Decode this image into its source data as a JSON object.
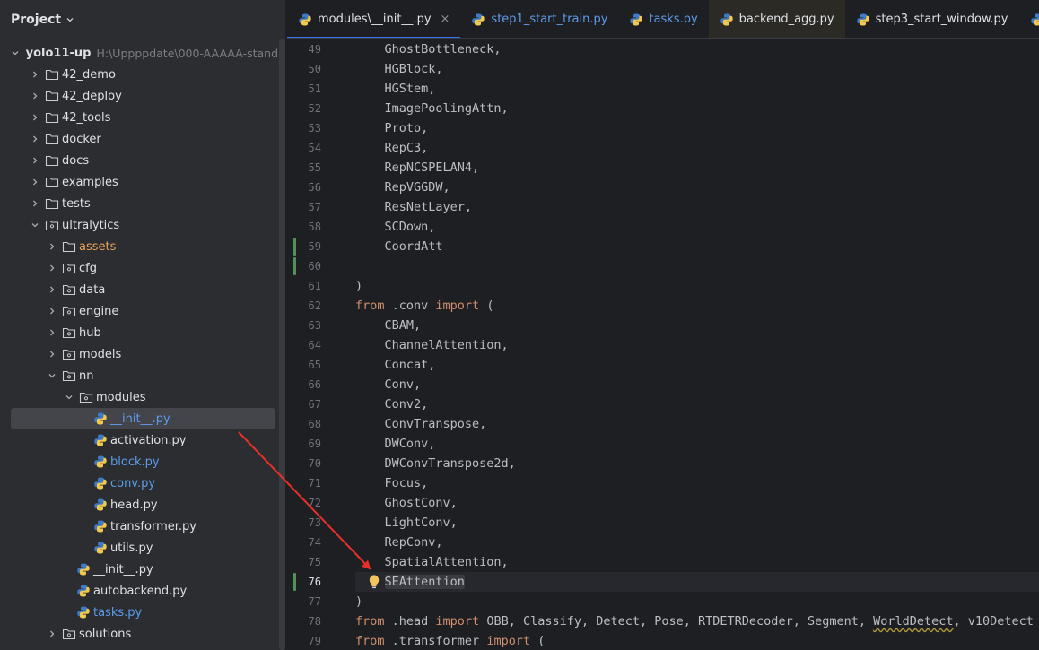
{
  "project_panel": {
    "title": "Project",
    "tree": [
      {
        "label": "yolo11-up",
        "path": "H:\\Uppppdate\\000-AAAAA-stand",
        "depth": 0,
        "expanded": true,
        "type": "folder",
        "style": "bold"
      },
      {
        "label": "42_demo",
        "depth": 1,
        "expanded": false,
        "type": "folder"
      },
      {
        "label": "42_deploy",
        "depth": 1,
        "expanded": false,
        "type": "folder"
      },
      {
        "label": "42_tools",
        "depth": 1,
        "expanded": false,
        "type": "folder"
      },
      {
        "label": "docker",
        "depth": 1,
        "expanded": false,
        "type": "folder"
      },
      {
        "label": "docs",
        "depth": 1,
        "expanded": false,
        "type": "folder"
      },
      {
        "label": "examples",
        "depth": 1,
        "expanded": false,
        "type": "folder"
      },
      {
        "label": "tests",
        "depth": 1,
        "expanded": false,
        "type": "folder"
      },
      {
        "label": "ultralytics",
        "depth": 1,
        "expanded": true,
        "type": "package"
      },
      {
        "label": "assets",
        "depth": 2,
        "expanded": false,
        "type": "folder",
        "style": "orange"
      },
      {
        "label": "cfg",
        "depth": 2,
        "expanded": false,
        "type": "package"
      },
      {
        "label": "data",
        "depth": 2,
        "expanded": false,
        "type": "package"
      },
      {
        "label": "engine",
        "depth": 2,
        "expanded": false,
        "type": "package"
      },
      {
        "label": "hub",
        "depth": 2,
        "expanded": false,
        "type": "package"
      },
      {
        "label": "models",
        "depth": 2,
        "expanded": false,
        "type": "package"
      },
      {
        "label": "nn",
        "depth": 2,
        "expanded": true,
        "type": "package"
      },
      {
        "label": "modules",
        "depth": 3,
        "expanded": true,
        "type": "package"
      },
      {
        "label": "__init__.py",
        "depth": 4,
        "type": "py",
        "style": "blue",
        "selected": true
      },
      {
        "label": "activation.py",
        "depth": 4,
        "type": "py"
      },
      {
        "label": "block.py",
        "depth": 4,
        "type": "py",
        "style": "blue"
      },
      {
        "label": "conv.py",
        "depth": 4,
        "type": "py",
        "style": "blue"
      },
      {
        "label": "head.py",
        "depth": 4,
        "type": "py"
      },
      {
        "label": "transformer.py",
        "depth": 4,
        "type": "py"
      },
      {
        "label": "utils.py",
        "depth": 4,
        "type": "py"
      },
      {
        "label": "__init__.py",
        "depth": 3,
        "type": "py"
      },
      {
        "label": "autobackend.py",
        "depth": 3,
        "type": "py"
      },
      {
        "label": "tasks.py",
        "depth": 3,
        "type": "py",
        "style": "blue"
      },
      {
        "label": "solutions",
        "depth": 2,
        "expanded": false,
        "type": "package"
      }
    ]
  },
  "editor": {
    "tabs": [
      {
        "label": "modules\\__init__.py",
        "active": true,
        "closable": true,
        "style": "mod"
      },
      {
        "label": "step1_start_train.py",
        "style": "blue"
      },
      {
        "label": "tasks.py",
        "style": "blue"
      },
      {
        "label": "backend_agg.py",
        "style": "plain",
        "highlight": true
      },
      {
        "label": "step3_start_window.py",
        "style": "plain"
      }
    ],
    "close_glyph": "×",
    "current_line": "76",
    "lines": [
      {
        "n": "49",
        "parts": [
          [
            "    GhostBottleneck,",
            ""
          ]
        ]
      },
      {
        "n": "50",
        "parts": [
          [
            "    HGBlock,",
            ""
          ]
        ]
      },
      {
        "n": "51",
        "parts": [
          [
            "    HGStem,",
            ""
          ]
        ]
      },
      {
        "n": "52",
        "parts": [
          [
            "    ImagePoolingAttn,",
            ""
          ]
        ]
      },
      {
        "n": "53",
        "parts": [
          [
            "    Proto,",
            ""
          ]
        ]
      },
      {
        "n": "54",
        "parts": [
          [
            "    RepC3,",
            ""
          ]
        ]
      },
      {
        "n": "55",
        "parts": [
          [
            "    RepNCSPELAN4,",
            ""
          ]
        ]
      },
      {
        "n": "56",
        "parts": [
          [
            "    RepVGGDW,",
            ""
          ]
        ]
      },
      {
        "n": "57",
        "parts": [
          [
            "    ResNetLayer,",
            ""
          ]
        ]
      },
      {
        "n": "58",
        "parts": [
          [
            "    SCDown,",
            ""
          ]
        ]
      },
      {
        "n": "59",
        "parts": [
          [
            "    CoordAtt",
            ""
          ]
        ],
        "changed": true
      },
      {
        "n": "60",
        "parts": [],
        "changed": true
      },
      {
        "n": "61",
        "parts": [
          [
            ")",
            ""
          ]
        ]
      },
      {
        "n": "62",
        "parts": [
          [
            "from",
            "kw"
          ],
          [
            " .conv ",
            ""
          ],
          [
            "import",
            "kw"
          ],
          [
            " (",
            ""
          ]
        ]
      },
      {
        "n": "63",
        "parts": [
          [
            "    CBAM,",
            ""
          ]
        ]
      },
      {
        "n": "64",
        "parts": [
          [
            "    ChannelAttention,",
            ""
          ]
        ]
      },
      {
        "n": "65",
        "parts": [
          [
            "    Concat,",
            ""
          ]
        ]
      },
      {
        "n": "66",
        "parts": [
          [
            "    Conv,",
            ""
          ]
        ]
      },
      {
        "n": "67",
        "parts": [
          [
            "    Conv2,",
            ""
          ]
        ]
      },
      {
        "n": "68",
        "parts": [
          [
            "    ConvTranspose,",
            ""
          ]
        ]
      },
      {
        "n": "69",
        "parts": [
          [
            "    DWConv,",
            ""
          ]
        ]
      },
      {
        "n": "70",
        "parts": [
          [
            "    DWConvTranspose2d,",
            ""
          ]
        ]
      },
      {
        "n": "71",
        "parts": [
          [
            "    Focus,",
            ""
          ]
        ]
      },
      {
        "n": "72",
        "parts": [
          [
            "    GhostConv,",
            ""
          ]
        ]
      },
      {
        "n": "73",
        "parts": [
          [
            "    LightConv,",
            ""
          ]
        ]
      },
      {
        "n": "74",
        "parts": [
          [
            "    RepConv,",
            ""
          ]
        ]
      },
      {
        "n": "75",
        "parts": [
          [
            "    SpatialAttention,",
            ""
          ]
        ]
      },
      {
        "n": "76",
        "parts": [
          [
            "    ",
            ""
          ],
          [
            "SEAttention",
            "hl"
          ]
        ],
        "changed": true,
        "current": true
      },
      {
        "n": "77",
        "parts": [
          [
            ")",
            ""
          ]
        ]
      },
      {
        "n": "78",
        "parts": [
          [
            "from",
            "kw"
          ],
          [
            " .head ",
            ""
          ],
          [
            "import",
            "kw"
          ],
          [
            " OBB, Classify, Detect, Pose, RTDETRDecoder, Segment, ",
            ""
          ],
          [
            "WorldDetect",
            "sq"
          ],
          [
            ", v10Detect",
            ""
          ]
        ]
      },
      {
        "n": "79",
        "parts": [
          [
            "from",
            "kw"
          ],
          [
            " .transformer ",
            ""
          ],
          [
            "import",
            "kw"
          ],
          [
            " (",
            ""
          ]
        ]
      }
    ]
  },
  "icons": {
    "panel_dropdown": "chevron-down-icon",
    "folder": "folder-icon",
    "python_file": "python-file-icon",
    "intention": "lightbulb-icon"
  },
  "colors": {
    "accent": "#3574f0",
    "keyword": "#cf8e6d",
    "vcs_changed": "#549159",
    "annotation_arrow": "#e8302a"
  }
}
